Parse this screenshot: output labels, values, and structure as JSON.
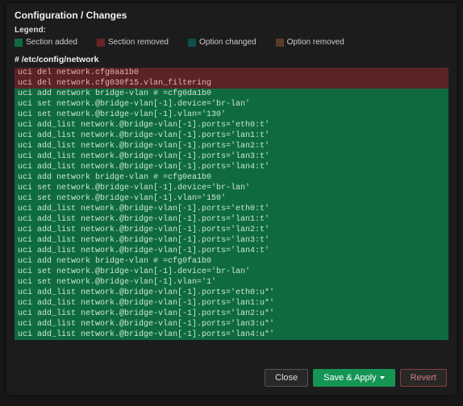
{
  "title": "Configuration / Changes",
  "legend": {
    "label": "Legend:",
    "items": [
      {
        "swatch": "sw-green",
        "text": "Section added"
      },
      {
        "swatch": "sw-red",
        "text": "Section removed"
      },
      {
        "swatch": "sw-teal",
        "text": "Option changed"
      },
      {
        "swatch": "sw-brown",
        "text": "Option removed"
      }
    ]
  },
  "file": "# /etc/config/network",
  "lines": [
    {
      "kind": "rem",
      "text": "uci del network.cfg0aa1b0"
    },
    {
      "kind": "rem",
      "text": "uci del network.cfg030f15.vlan_filtering"
    },
    {
      "kind": "add",
      "text": "uci add network bridge-vlan # =cfg0da1b0"
    },
    {
      "kind": "add",
      "text": "uci set network.@bridge-vlan[-1].device='br-lan'"
    },
    {
      "kind": "add",
      "text": "uci set network.@bridge-vlan[-1].vlan='130'"
    },
    {
      "kind": "add",
      "text": "uci add_list network.@bridge-vlan[-1].ports='eth0:t'"
    },
    {
      "kind": "add",
      "text": "uci add_list network.@bridge-vlan[-1].ports='lan1:t'"
    },
    {
      "kind": "add",
      "text": "uci add_list network.@bridge-vlan[-1].ports='lan2:t'"
    },
    {
      "kind": "add",
      "text": "uci add_list network.@bridge-vlan[-1].ports='lan3:t'"
    },
    {
      "kind": "add",
      "text": "uci add_list network.@bridge-vlan[-1].ports='lan4:t'"
    },
    {
      "kind": "add",
      "text": "uci add network bridge-vlan # =cfg0ea1b0"
    },
    {
      "kind": "add",
      "text": "uci set network.@bridge-vlan[-1].device='br-lan'"
    },
    {
      "kind": "add",
      "text": "uci set network.@bridge-vlan[-1].vlan='150'"
    },
    {
      "kind": "add",
      "text": "uci add_list network.@bridge-vlan[-1].ports='eth0:t'"
    },
    {
      "kind": "add",
      "text": "uci add_list network.@bridge-vlan[-1].ports='lan1:t'"
    },
    {
      "kind": "add",
      "text": "uci add_list network.@bridge-vlan[-1].ports='lan2:t'"
    },
    {
      "kind": "add",
      "text": "uci add_list network.@bridge-vlan[-1].ports='lan3:t'"
    },
    {
      "kind": "add",
      "text": "uci add_list network.@bridge-vlan[-1].ports='lan4:t'"
    },
    {
      "kind": "add",
      "text": "uci add network bridge-vlan # =cfg0fa1b0"
    },
    {
      "kind": "add",
      "text": "uci set network.@bridge-vlan[-1].device='br-lan'"
    },
    {
      "kind": "add",
      "text": "uci set network.@bridge-vlan[-1].vlan='1'"
    },
    {
      "kind": "add",
      "text": "uci add_list network.@bridge-vlan[-1].ports='eth0:u*'"
    },
    {
      "kind": "add",
      "text": "uci add_list network.@bridge-vlan[-1].ports='lan1:u*'"
    },
    {
      "kind": "add",
      "text": "uci add_list network.@bridge-vlan[-1].ports='lan2:u*'"
    },
    {
      "kind": "add",
      "text": "uci add_list network.@bridge-vlan[-1].ports='lan3:u*'"
    },
    {
      "kind": "add",
      "text": "uci add_list network.@bridge-vlan[-1].ports='lan4:u*'"
    }
  ],
  "buttons": {
    "close": "Close",
    "apply": "Save & Apply",
    "revert": "Revert"
  }
}
